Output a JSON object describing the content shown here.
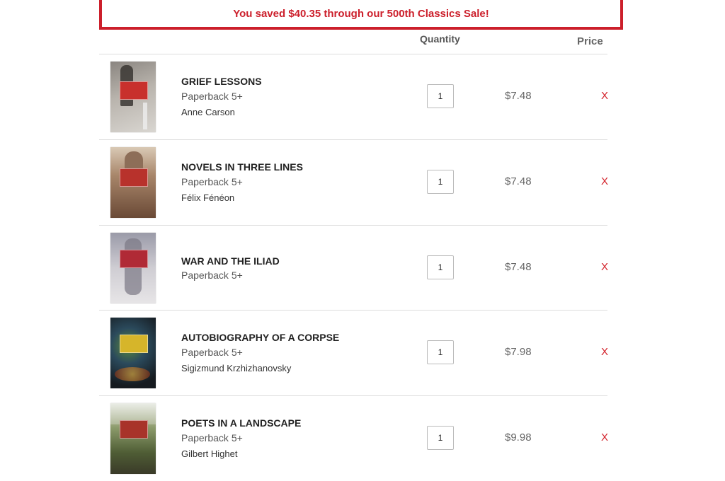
{
  "banner": {
    "text": "You saved $40.35 through our 500th Classics Sale!"
  },
  "columns": {
    "quantity": "Quantity",
    "price": "Price"
  },
  "items": [
    {
      "title": "GRIEF LESSONS",
      "format": "Paperback 5+",
      "author": "Anne Carson",
      "quantity": "1",
      "price": "$7.48",
      "remove": "X"
    },
    {
      "title": "NOVELS IN THREE LINES",
      "format": "Paperback 5+",
      "author": "Félix Fénéon",
      "quantity": "1",
      "price": "$7.48",
      "remove": "X"
    },
    {
      "title": "WAR AND THE ILIAD",
      "format": "Paperback 5+",
      "author": "",
      "quantity": "1",
      "price": "$7.48",
      "remove": "X"
    },
    {
      "title": "AUTOBIOGRAPHY OF A CORPSE",
      "format": "Paperback 5+",
      "author": "Sigizmund Krzhizhanovsky",
      "quantity": "1",
      "price": "$7.98",
      "remove": "X"
    },
    {
      "title": "POETS IN A LANDSCAPE",
      "format": "Paperback 5+",
      "author": "Gilbert Highet",
      "quantity": "1",
      "price": "$9.98",
      "remove": "X"
    }
  ],
  "colors": {
    "accent": "#cc1f2b",
    "remove": "#d3232c"
  }
}
